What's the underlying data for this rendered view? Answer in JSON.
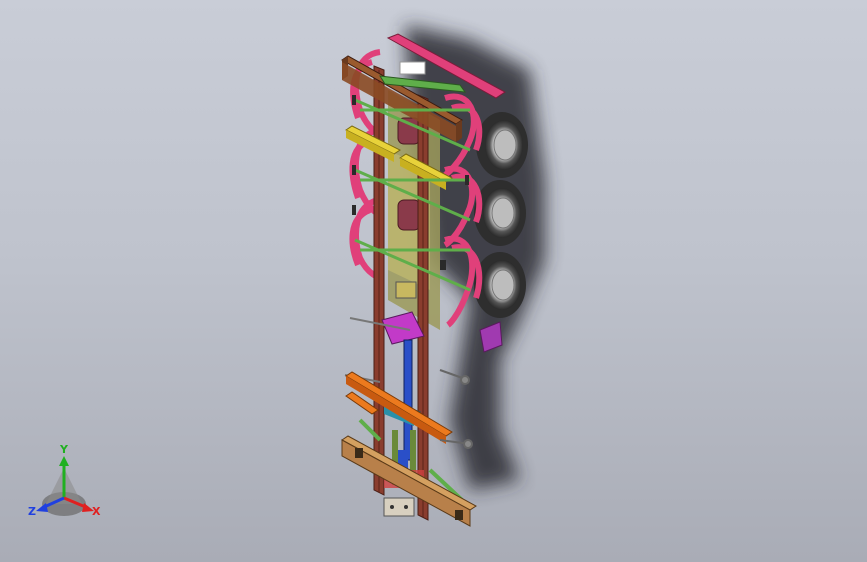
{
  "viewport": {
    "background_top": "#c9cdd7",
    "background_bottom": "#a9acb6"
  },
  "model": {
    "description_icon": "trailer-chassis-3d-model",
    "colors": {
      "frame_rail": "#8a3d2e",
      "frame_edge": "#4a1e15",
      "crossmember_yellow": "#e8d23a",
      "crossmember_orange": "#ec7a1e",
      "crossmember_cyan": "#3fb4c8",
      "tire_dark": "#3a3a3a",
      "tire_light": "#dcdcdc",
      "fender_pink": "#e0407a",
      "deck_olive": "#9c9a5a",
      "bracket_magenta": "#c23ac8",
      "shadow": "#2a2a30",
      "green_strut": "#5fae4a",
      "blue_part": "#2a4fc8",
      "tan_beam": "#b8804a"
    }
  },
  "triad": {
    "x_label": "X",
    "y_label": "Y",
    "z_label": "Z",
    "x_color": "#e02020",
    "y_color": "#20b020",
    "z_color": "#2040e0"
  }
}
